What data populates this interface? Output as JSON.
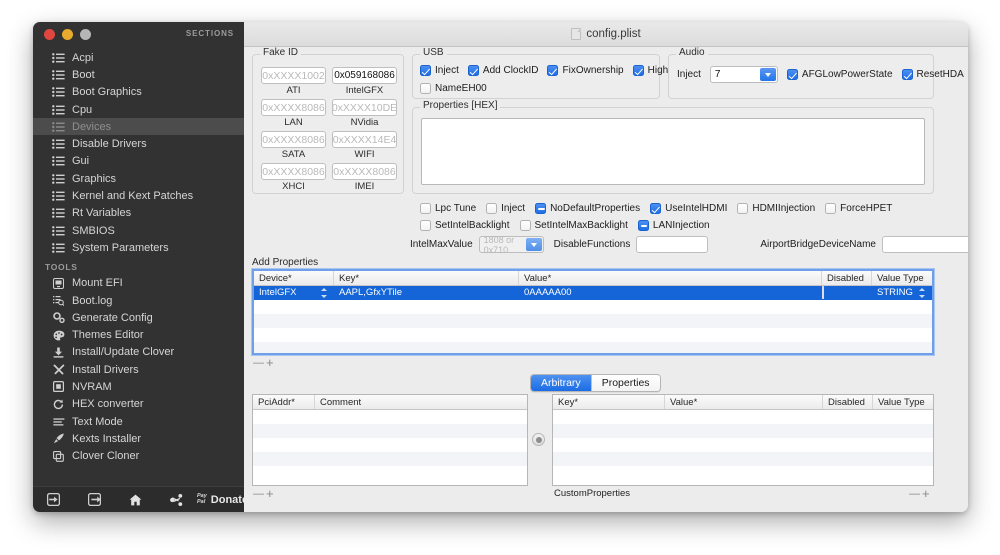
{
  "window": {
    "title": "config.plist",
    "doc_icon": "document-icon",
    "traffic_lights": [
      "close-button",
      "minimize-button",
      "zoom-button"
    ]
  },
  "sidebar": {
    "sections_header": "SECTIONS",
    "tools_header": "TOOLS",
    "sections": [
      {
        "label": "Acpi",
        "icon": "list-icon",
        "selected": false
      },
      {
        "label": "Boot",
        "icon": "list-icon",
        "selected": false
      },
      {
        "label": "Boot Graphics",
        "icon": "list-icon",
        "selected": false
      },
      {
        "label": "Cpu",
        "icon": "list-icon",
        "selected": false
      },
      {
        "label": "Devices",
        "icon": "list-icon",
        "selected": true
      },
      {
        "label": "Disable Drivers",
        "icon": "list-icon",
        "selected": false
      },
      {
        "label": "Gui",
        "icon": "list-icon",
        "selected": false
      },
      {
        "label": "Graphics",
        "icon": "list-icon",
        "selected": false
      },
      {
        "label": "Kernel and Kext Patches",
        "icon": "list-icon",
        "selected": false
      },
      {
        "label": "Rt Variables",
        "icon": "list-icon",
        "selected": false
      },
      {
        "label": "SMBIOS",
        "icon": "list-icon",
        "selected": false
      },
      {
        "label": "System Parameters",
        "icon": "list-icon",
        "selected": false
      }
    ],
    "tools": [
      {
        "label": "Mount EFI",
        "icon": "drive-icon"
      },
      {
        "label": "Boot.log",
        "icon": "log-search-icon"
      },
      {
        "label": "Generate Config",
        "icon": "gears-icon"
      },
      {
        "label": "Themes Editor",
        "icon": "palette-icon"
      },
      {
        "label": "Install/Update Clover",
        "icon": "download-icon"
      },
      {
        "label": "Install Drivers",
        "icon": "tools-icon"
      },
      {
        "label": "NVRAM",
        "icon": "chip-icon"
      },
      {
        "label": "HEX converter",
        "icon": "refresh-icon"
      },
      {
        "label": "Text Mode",
        "icon": "text-lines-icon"
      },
      {
        "label": "Kexts Installer",
        "icon": "rocket-icon"
      },
      {
        "label": "Clover Cloner",
        "icon": "copy-icon"
      }
    ],
    "toolbar": {
      "import_icon": "import-arrow-icon",
      "export_icon": "export-arrow-icon",
      "home_icon": "home-icon",
      "share_icon": "share-icon",
      "paypal_line1": "Pay",
      "paypal_line2": "Pal",
      "donate_label": "Donate"
    }
  },
  "fake_id": {
    "group_label": "Fake ID",
    "fields": [
      {
        "label": "ATI",
        "value": "",
        "placeholder": "0xXXXX1002"
      },
      {
        "label": "IntelGFX",
        "value": "0x059168086",
        "placeholder": "0xXXXX8086"
      },
      {
        "label": "LAN",
        "value": "",
        "placeholder": "0xXXXX8086"
      },
      {
        "label": "NVidia",
        "value": "",
        "placeholder": "0xXXXX10DE"
      },
      {
        "label": "SATA",
        "value": "",
        "placeholder": "0xXXXX8086"
      },
      {
        "label": "WIFI",
        "value": "",
        "placeholder": "0xXXXX14E4"
      },
      {
        "label": "XHCI",
        "value": "",
        "placeholder": "0xXXXX8086"
      },
      {
        "label": "IMEI",
        "value": "",
        "placeholder": "0xXXXX8086"
      }
    ]
  },
  "usb": {
    "group_label": "USB",
    "checkboxes": [
      {
        "label": "Inject",
        "state": "on"
      },
      {
        "label": "Add ClockID",
        "state": "on"
      },
      {
        "label": "FixOwnership",
        "state": "on"
      },
      {
        "label": "HighCurrent",
        "state": "on"
      },
      {
        "label": "NameEH00",
        "state": "off"
      }
    ]
  },
  "audio": {
    "group_label": "Audio",
    "inject_label": "Inject",
    "inject_value": "7",
    "checkboxes": [
      {
        "label": "AFGLowPowerState",
        "state": "on"
      },
      {
        "label": "ResetHDA",
        "state": "on"
      }
    ]
  },
  "properties_hex": {
    "group_label": "Properties [HEX]",
    "textarea_value": "",
    "checkbox_row1": [
      {
        "label": "Lpc Tune",
        "state": "off"
      },
      {
        "label": "Inject",
        "state": "off"
      },
      {
        "label": "NoDefaultProperties",
        "state": "mixed"
      },
      {
        "label": "UseIntelHDMI",
        "state": "on"
      },
      {
        "label": "HDMIInjection",
        "state": "off"
      },
      {
        "label": "ForceHPET",
        "state": "off"
      }
    ],
    "checkbox_row2": [
      {
        "label": "SetIntelBacklight",
        "state": "off"
      },
      {
        "label": "SetIntelMaxBacklight",
        "state": "off"
      },
      {
        "label": "LANInjection",
        "state": "mixed"
      }
    ],
    "intel_max_value_label": "IntelMaxValue",
    "intel_max_value": "",
    "intel_max_value_placeholder": "1808 or 0x710",
    "disable_functions_label": "DisableFunctions",
    "disable_functions_value": "",
    "airport_bridge_label": "AirportBridgeDeviceName",
    "airport_bridge_value": ""
  },
  "add_properties": {
    "group_label": "Add Properties",
    "columns": [
      "Device*",
      "Key*",
      "Value*",
      "Disabled",
      "Value Type"
    ],
    "rows": [
      {
        "device": "IntelGFX",
        "key": "AAPL,GfxYTile",
        "value": "0AAAAA00",
        "disabled": false,
        "value_type": "STRING",
        "selected": true
      }
    ],
    "empty_row_count": 4,
    "remove_label": "—",
    "add_label": "+"
  },
  "bottom": {
    "tabs": [
      {
        "label": "Arbitrary",
        "active": true
      },
      {
        "label": "Properties",
        "active": false
      }
    ],
    "left_table": {
      "columns": [
        "PciAddr*",
        "Comment"
      ],
      "rows": [],
      "empty_row_count": 5,
      "remove_label": "—",
      "add_label": "+"
    },
    "right_table": {
      "columns": [
        "Key*",
        "Value*",
        "Disabled",
        "Value Type"
      ],
      "rows": [],
      "empty_row_count": 5,
      "remove_label": "—",
      "add_label": "+"
    },
    "custom_properties_label": "CustomProperties",
    "link_icon": "link-dot-icon"
  },
  "colors": {
    "accent": "#1a6ce6",
    "selection": "#1565d8",
    "sidebar_bg": "#323232",
    "sidebar_selected": "#4c4c4c",
    "window_bg": "#ececec"
  }
}
